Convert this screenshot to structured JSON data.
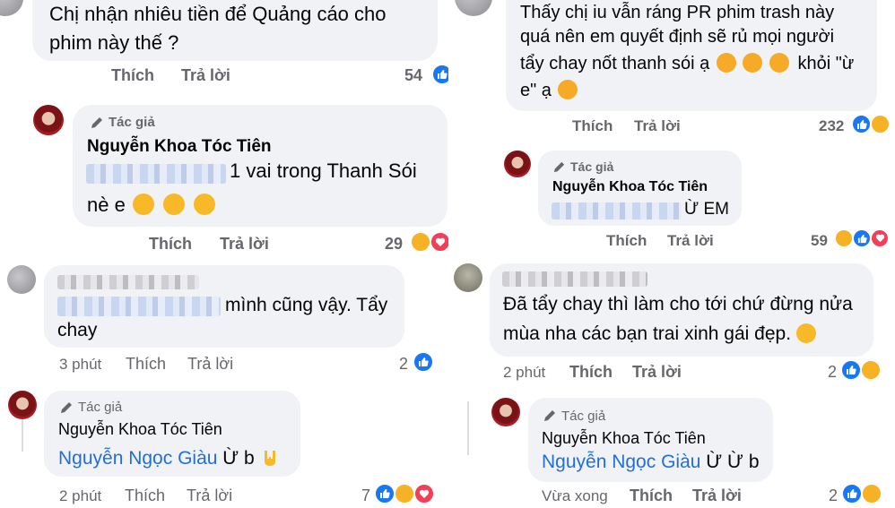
{
  "labels": {
    "like": "Thích",
    "reply": "Trả lời",
    "author_tag": "Tác giả"
  },
  "left": {
    "c1": {
      "text_line1": "Chị nhận nhiêu tiền để Quảng cáo cho",
      "text_line2": "phim này thế ?",
      "reactions": "54"
    },
    "r1": {
      "author": "Nguyễn Khoa Tóc Tiên",
      "text_line1_suffix": "1 vai trong Thanh Sói",
      "text_line2": "nè e",
      "reactions": "29"
    },
    "c2": {
      "text_line1_suffix": "mình cũng vậy. Tẩy",
      "text_line2": "chay",
      "time": "3 phút",
      "reactions": "2"
    },
    "r2": {
      "author": "Nguyễn Khoa Tóc Tiên",
      "mention": "Nguyễn Ngọc Giàu",
      "text_suffix": "Ừ b",
      "time": "2 phút",
      "reactions": "7"
    }
  },
  "right": {
    "c1": {
      "text_line1": "Thấy chị iu vẫn ráng PR phim trash này",
      "text_line2": "quá nên em quyết định sẽ rủ mọi người",
      "text_line3a": "tẩy chay nốt thanh sói ạ",
      "text_line3b": "khỏi \"ừ",
      "text_line4a": "e\" ạ",
      "reactions": "232"
    },
    "r1": {
      "author": "Nguyễn Khoa Tóc Tiên",
      "text_suffix": "Ừ EM",
      "reactions": "59"
    },
    "c2": {
      "text_line1": "Đã tẩy chay thì làm cho tới chứ đừng nửa",
      "text_line2": "mùa nha các bạn trai xinh gái đẹp.",
      "time": "2 phút",
      "reactions": "2"
    },
    "r2": {
      "author": "Nguyễn Khoa Tóc Tiên",
      "mention": "Nguyễn Ngọc Giàu",
      "text_suffix": "Ừ Ừ b",
      "time": "Vừa xong",
      "reactions": "2"
    }
  },
  "icons": {
    "like": "thumbs-up",
    "haha": "laughing-face",
    "love": "heart",
    "pen": "pen",
    "heart_eyes_cat": "smiling-cat-heart-eyes",
    "yawn": "yawning-face",
    "rock_on": "sign-of-horns"
  }
}
